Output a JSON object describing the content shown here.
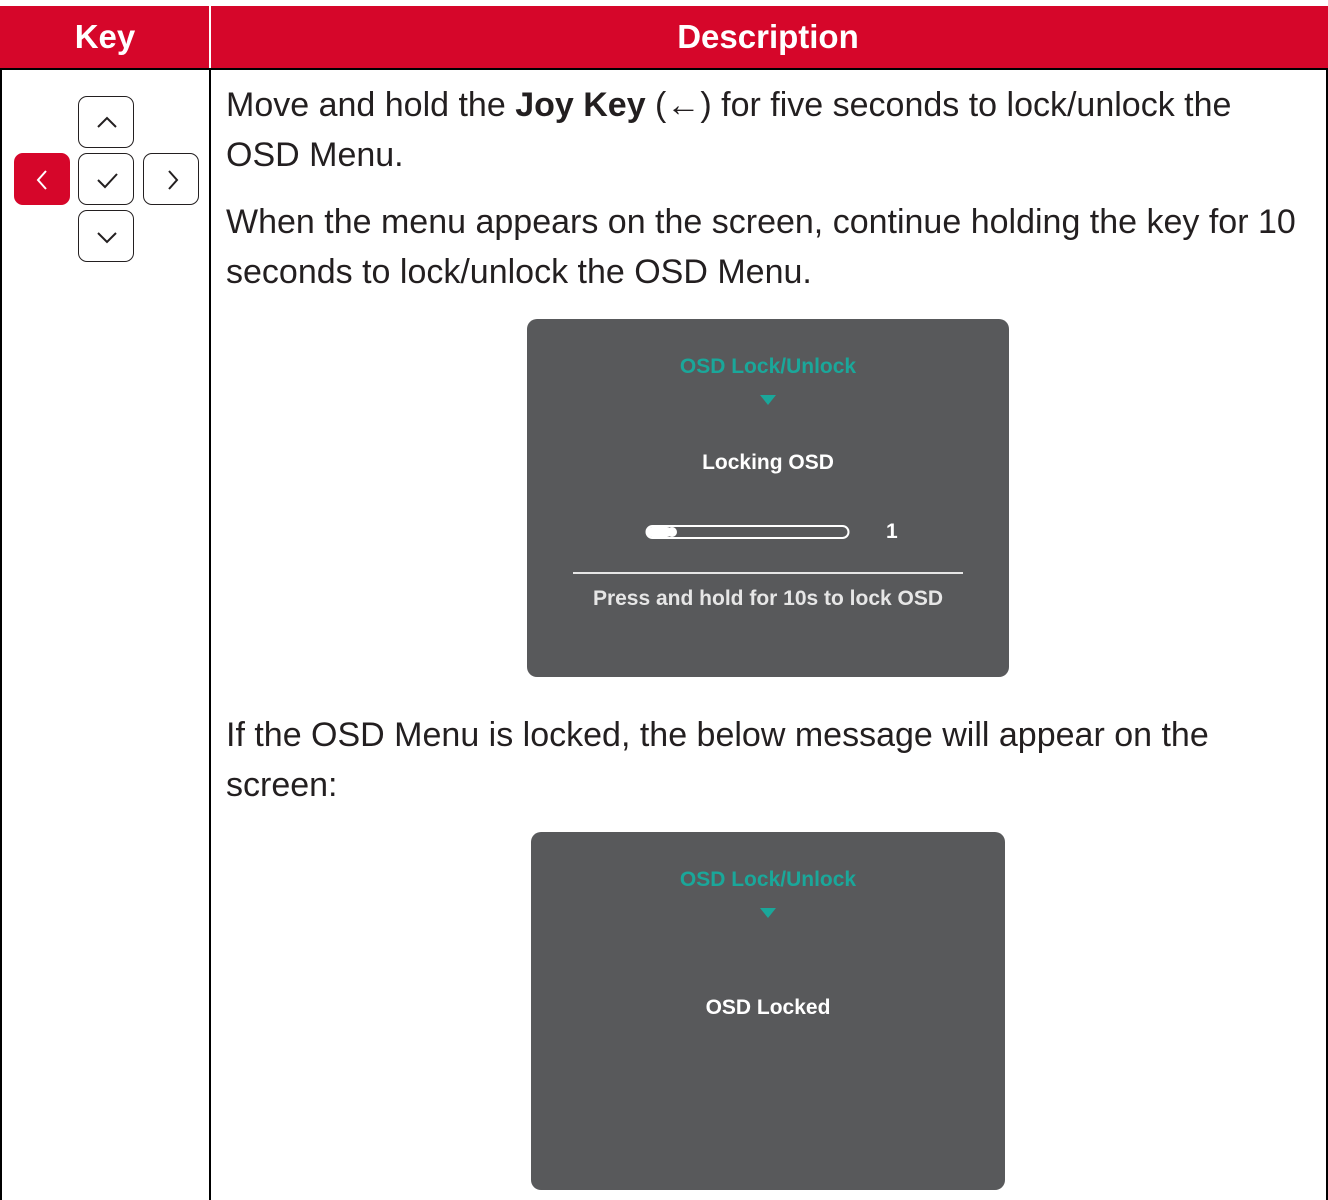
{
  "table": {
    "header": {
      "key": "Key",
      "description": "Description"
    }
  },
  "colors": {
    "accent": "#d6062a",
    "osd_bg": "#58595b",
    "osd_accent": "#1aa79a"
  },
  "joy_key": {
    "buttons": [
      {
        "name": "up",
        "icon": "chevron-up-icon",
        "active": false
      },
      {
        "name": "left",
        "icon": "chevron-left-icon",
        "active": true
      },
      {
        "name": "center",
        "icon": "check-icon",
        "active": false
      },
      {
        "name": "right",
        "icon": "chevron-right-icon",
        "active": false
      },
      {
        "name": "down",
        "icon": "chevron-down-icon",
        "active": false
      }
    ]
  },
  "description": {
    "p1_before": "Move and hold the ",
    "p1_bold": "Joy Key",
    "p1_after": " (←) for five seconds to lock/unlock the OSD Menu.",
    "p2": "When the menu appears on the screen, continue holding the key for 10 seconds to lock/unlock the OSD Menu.",
    "p3": "If the OSD Menu is locked, the below message will appear on the screen:"
  },
  "osd1": {
    "title": "OSD Lock/Unlock",
    "status": "Locking OSD",
    "progress_value": "1",
    "progress_fraction": 0.1,
    "hint": "Press and hold for 10s to lock OSD"
  },
  "osd2": {
    "title": "OSD Lock/Unlock",
    "status": "OSD Locked"
  }
}
